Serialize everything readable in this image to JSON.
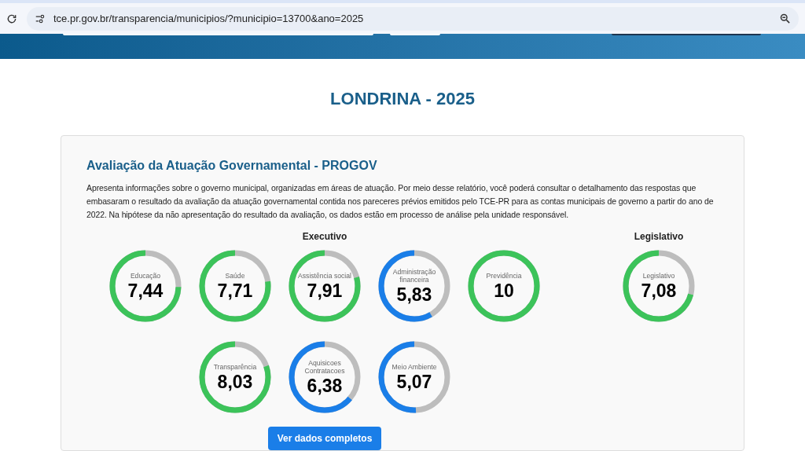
{
  "browser": {
    "url": "tce.pr.gov.br/transparencia/municipios/?municipio=13700&ano=2025"
  },
  "page_title": "LONDRINA - 2025",
  "card": {
    "title": "Avaliação da Atuação Governamental - PROGOV",
    "description": "Apresenta informações sobre o governo municipal, organizadas em áreas de atuação. Por meio desse relatório, você poderá consultar o detalhamento das respostas que embasaram o resultado da avaliação da atuação governamental contida nos pareceres prévios emitidos pelo TCE-PR para as contas municipais de governo a partir do ano de 2022. Na hipótese da não apresentação do resultado da avaliação, os dados estão em processo de análise pela unidade responsável.",
    "sections": [
      {
        "heading": "Executivo",
        "gauges": [
          {
            "label": "Educação",
            "value": "7,44",
            "level": 0.744,
            "color": "#3cc35a"
          },
          {
            "label": "Saúde",
            "value": "7,71",
            "level": 0.771,
            "color": "#3cc35a"
          },
          {
            "label": "Assistência social",
            "value": "7,91",
            "level": 0.791,
            "color": "#3cc35a"
          },
          {
            "label": "Administração financeira",
            "value": "5,83",
            "level": 0.583,
            "color": "#1a7ee8"
          },
          {
            "label": "Previdência",
            "value": "10",
            "level": 1,
            "color": "#3cc35a"
          },
          {
            "label": "Transparência",
            "value": "8,03",
            "level": 0.803,
            "color": "#3cc35a"
          },
          {
            "label": "Aquisicoes Contratacoes",
            "value": "6,38",
            "level": 0.638,
            "color": "#1a7ee8"
          },
          {
            "label": "Meio Ambiente",
            "value": "5,07",
            "level": 0.507,
            "color": "#1a7ee8"
          }
        ]
      },
      {
        "heading": "Legislativo",
        "gauges": [
          {
            "label": "Legislativo",
            "value": "7,08",
            "level": 0.708,
            "color": "#3cc35a"
          }
        ]
      }
    ],
    "button": "Ver dados completos"
  }
}
